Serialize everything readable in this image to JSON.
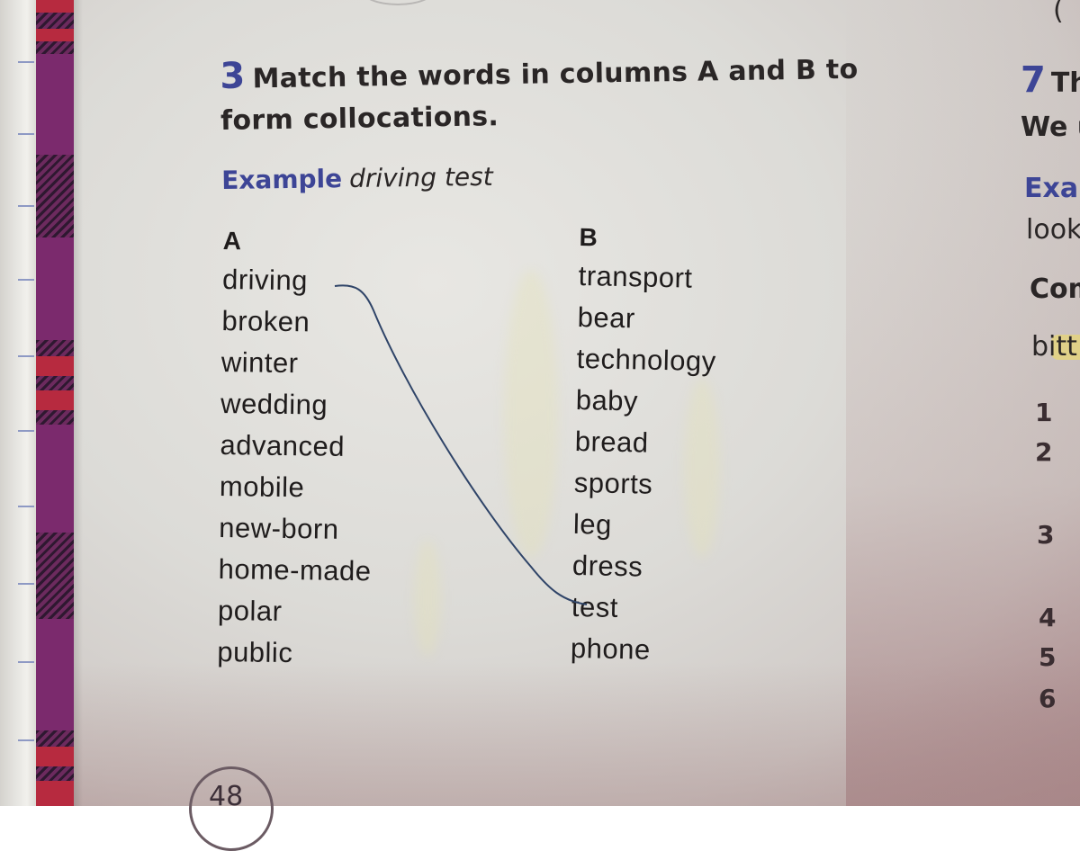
{
  "exercise": {
    "number": "3",
    "instruction": "Match the words in columns A and B to form collocations.",
    "instruction_line1": "Match the words in columns A and B to",
    "instruction_line2": "form collocations.",
    "example_label": "Example",
    "example_text": "driving test",
    "column_a": {
      "header": "A",
      "items": [
        "driving",
        "broken",
        "winter",
        "wedding",
        "advanced",
        "mobile",
        "new-born",
        "home-made",
        "polar",
        "public"
      ]
    },
    "column_b": {
      "header": "B",
      "items": [
        "transport",
        "bear",
        "technology",
        "baby",
        "bread",
        "sports",
        "leg",
        "dress",
        "test",
        "phone"
      ]
    },
    "drawn_matches": [
      {
        "from": "driving",
        "to": "test",
        "color": "#2f4468"
      }
    ]
  },
  "right_page": {
    "exercise_number": "7",
    "title_fragment": "Th",
    "line2_fragment": "We u",
    "example_fragment": "Exar",
    "example_text_fragment": "look",
    "subheading_fragment": "Com",
    "word_fragment": "bitt",
    "item_numbers": [
      "1",
      "2",
      "3",
      "4",
      "5",
      "6"
    ],
    "bracket_fragment": "("
  },
  "page_number": "48",
  "colors": {
    "accent_blue": "#3d4596",
    "text": "#2a2626",
    "tartan_purple": "#7b2a6d",
    "tartan_red": "#b72a3f",
    "pen_line": "#2f4468"
  }
}
